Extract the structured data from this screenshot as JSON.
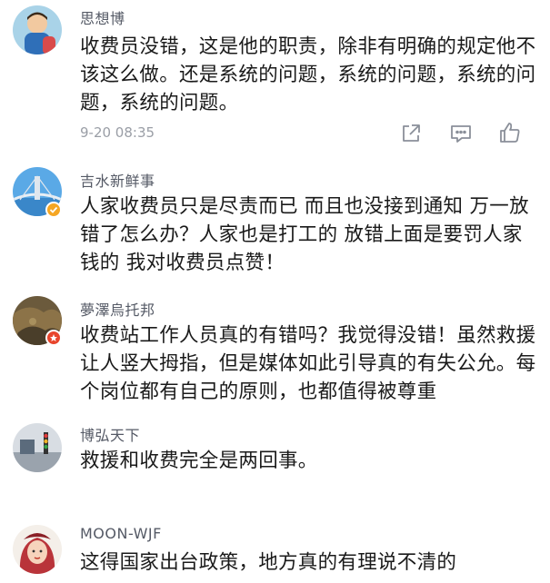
{
  "comments": [
    {
      "username": "思想博",
      "text": "收费员没错，这是他的职责，除非有明确的规定他不该这么做。还是系统的问题，系统的问题，系统的问题，系统的问题。",
      "timestamp": "9-20 08:35",
      "avatar_icon": "cartoon-avatar-icon",
      "actions": [
        "share-icon",
        "comment-icon",
        "like-icon"
      ]
    },
    {
      "username": "吉水新鲜事",
      "text": "人家收费员只是尽责而已  而且也没接到通知  万一放错了怎么办？人家也是打工的  放错上面是要罚人家钱的  我对收费员点赞！",
      "avatar_icon": "bridge-photo-avatar-icon",
      "badge": "verified-badge-icon",
      "badge_color": "#f5a623"
    },
    {
      "username": "夢澤烏托邦",
      "text": "收费站工作人员真的有错吗？我觉得没错！虽然救援让人竖大拇指，但是媒体如此引导真的有失公允。每个岗位都有自己的原则，也都值得被尊重",
      "avatar_icon": "rock-photo-avatar-icon",
      "badge": "vip-badge-icon",
      "badge_color": "#e8452c"
    },
    {
      "username": "博弘天下",
      "text": "救援和收费完全是两回事。",
      "avatar_icon": "traffic-scene-avatar-icon"
    },
    {
      "username": "MOON-WJF",
      "text": "这得国家出台政策，地方真的有理说不清的",
      "avatar_icon": "woman-cartoon-avatar-icon"
    }
  ],
  "colors": {
    "username": "#555a66",
    "text": "#1a1a1a",
    "meta": "#9a9ea6",
    "icon": "#8a8f99"
  }
}
